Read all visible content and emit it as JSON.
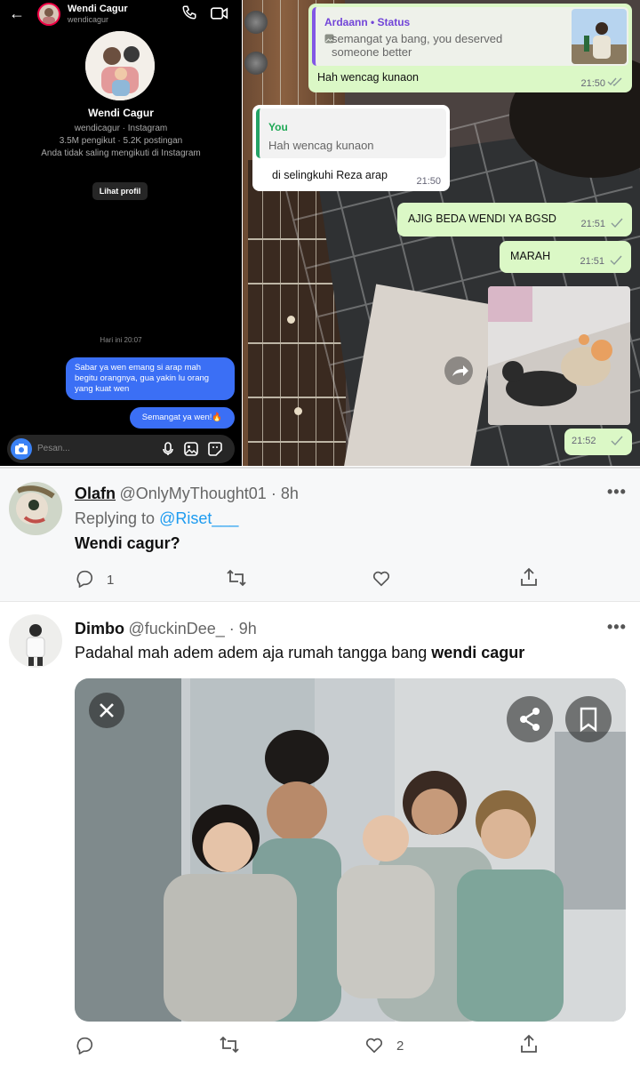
{
  "instagram": {
    "header_name": "Wendi Cagur",
    "header_handle": "wendicagur",
    "profile_name": "Wendi Cagur",
    "profile_line1": "wendicagur · Instagram",
    "profile_line2": "3.5M pengikut · 5.2K postingan",
    "profile_line3": "Anda tidak saling mengikuti di Instagram",
    "profile_button": "Lihat profil",
    "timestamp": "Hari ini 20:07",
    "messages": [
      "Sabar ya wen emang si arap mah begitu orangnya, gua yakin lu orang yang kuat wen",
      "Semangat ya wen!🔥"
    ],
    "composer_placeholder": "Pesan..."
  },
  "whatsapp": {
    "msg1": {
      "quote_author": "Ardaann • Status",
      "quote_text": "semangat ya bang, you deserved someone better",
      "text": "Hah wencag kunaon",
      "time": "21:50"
    },
    "msg2": {
      "quote_author": "You",
      "quote_text": "Hah wencag kunaon",
      "text": "di selingkuhi Reza arap",
      "time": "21:50"
    },
    "msg3": {
      "text": "AJIG BEDA WENDI YA BGSD",
      "time": "21:51"
    },
    "msg4": {
      "text": "MARAH",
      "time": "21:51"
    },
    "msg5": {
      "time": "21:52"
    }
  },
  "twitter": {
    "tweet1": {
      "name": "Olafn",
      "handle": "@OnlyMyThought01 · 8h",
      "replying_prefix": "Replying to ",
      "replying_to": "@Riset___",
      "text": "Wendi cagur?",
      "reply_count": "1"
    },
    "tweet2": {
      "name": "Dimbo",
      "handle": "@fuckinDee_ · 9h",
      "text_plain": "Padahal mah adem adem aja rumah tangga bang ",
      "text_bold": "wendi cagur",
      "like_count": "2"
    },
    "colors": {
      "link": "#1d9bf0",
      "ig_bubble": "#3b6ff5",
      "wa_out": "#dbf8c6"
    }
  }
}
